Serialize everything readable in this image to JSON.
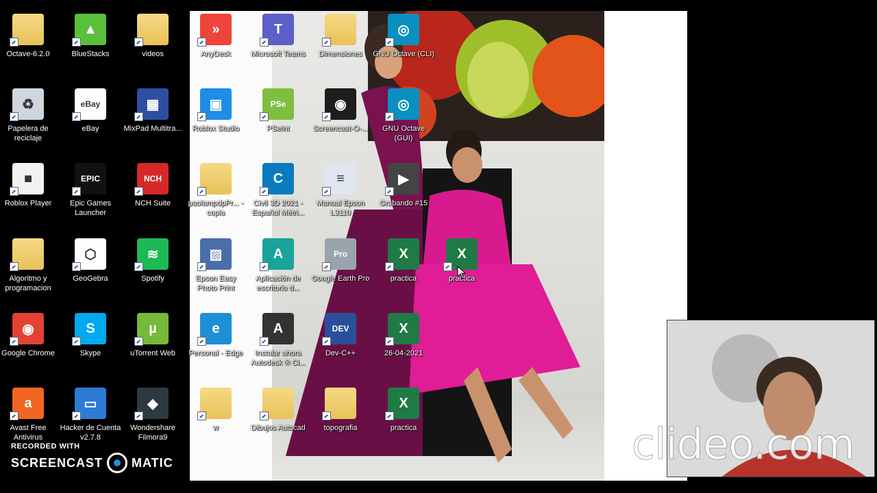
{
  "desktop": {
    "icons": [
      {
        "label": "Octave-6.2.0",
        "icon": "folder-icon",
        "color": "#f3d07a"
      },
      {
        "label": "BlueStacks",
        "icon": "bluestacks-icon",
        "color": "#5ac03a"
      },
      {
        "label": "videos",
        "icon": "folder-icon",
        "color": "#f3d07a"
      },
      {
        "label": "AnyDesk",
        "icon": "anydesk-icon",
        "color": "#ef443b"
      },
      {
        "label": "Microsoft Teams",
        "icon": "teams-icon",
        "color": "#5b5fc7"
      },
      {
        "label": "Dimensiones",
        "icon": "folder-icon",
        "color": "#f3d07a"
      },
      {
        "label": "GNU Octave (CLI)",
        "icon": "octave-icon",
        "color": "#0790c0"
      },
      {
        "label": "Papelera de reciclaje",
        "icon": "recycle-bin-icon",
        "color": "#cfd6dd"
      },
      {
        "label": "eBay",
        "icon": "ebay-icon",
        "color": "#ffffff"
      },
      {
        "label": "MixPad Multitra...",
        "icon": "mixpad-icon",
        "color": "#2d4fa3"
      },
      {
        "label": "Roblox Studio",
        "icon": "roblox-studio-icon",
        "color": "#1e8ce8"
      },
      {
        "label": "PSeInt",
        "icon": "pseint-icon",
        "color": "#7fbf3f"
      },
      {
        "label": "Screencast-O-...",
        "icon": "screencast-icon",
        "color": "#1d1d1d"
      },
      {
        "label": "GNU Octave (GUI)",
        "icon": "octave-icon",
        "color": "#0790c0"
      },
      {
        "label": "Roblox Player",
        "icon": "roblox-icon",
        "color": "#f2f2f2"
      },
      {
        "label": "Epic Games Launcher",
        "icon": "epic-games-icon",
        "color": "#111111"
      },
      {
        "label": "NCH Suite",
        "icon": "nch-icon",
        "color": "#d62828"
      },
      {
        "label": "paolampdpPr... - copia",
        "icon": "folder-icon",
        "color": "#f3d07a"
      },
      {
        "label": "Civil 3D 2021 - Español Métri...",
        "icon": "civil3d-icon",
        "color": "#0b7bbf"
      },
      {
        "label": "Manual Epson L3110",
        "icon": "document-icon",
        "color": "#dfe6ef"
      },
      {
        "label": "Grabando #15",
        "icon": "video-file-icon",
        "color": "#444444"
      },
      {
        "label": "Algoritmo y programacion",
        "icon": "folder-icon",
        "color": "#f3d07a"
      },
      {
        "label": "GeoGebra",
        "icon": "geogebra-icon",
        "color": "#ffffff"
      },
      {
        "label": "Spotify",
        "icon": "spotify-icon",
        "color": "#1db954"
      },
      {
        "label": "Epson Easy Photo Print",
        "icon": "epson-photo-icon",
        "color": "#4a6ea8"
      },
      {
        "label": "Aplicación de escritorio d...",
        "icon": "autodesk-app-icon",
        "color": "#1aa39a"
      },
      {
        "label": "Google Earth Pro",
        "icon": "google-earth-icon",
        "color": "#9aa4ad"
      },
      {
        "label": "practica",
        "icon": "excel-file-icon",
        "color": "#1f7a45"
      },
      {
        "label": "practica",
        "icon": "excel-file-icon",
        "color": "#1f7a45"
      },
      {
        "label": "Google Chrome",
        "icon": "chrome-icon",
        "color": "#e34133"
      },
      {
        "label": "Skype",
        "icon": "skype-icon",
        "color": "#00a9f0"
      },
      {
        "label": "uTorrent Web",
        "icon": "utorrent-icon",
        "color": "#78b83a"
      },
      {
        "label": "Personal - Edge",
        "icon": "edge-icon",
        "color": "#1d8fd6"
      },
      {
        "label": "Instalar ahora Autodesk ® Ci...",
        "icon": "autodesk-install-icon",
        "color": "#333333"
      },
      {
        "label": "Dev-C++",
        "icon": "devcpp-icon",
        "color": "#2a4f9a"
      },
      {
        "label": "26-04-2021",
        "icon": "excel-file-icon",
        "color": "#1f7a45"
      },
      {
        "label": "Avast Free Antivirus",
        "icon": "avast-icon",
        "color": "#f26522"
      },
      {
        "label": "Hacker de Cuenta v2.7.8",
        "icon": "app-window-icon",
        "color": "#2e7bd6"
      },
      {
        "label": "Wondershare Filmora9",
        "icon": "filmora-icon",
        "color": "#2b3a3f"
      },
      {
        "label": "w",
        "icon": "folder-icon",
        "color": "#f3d07a"
      },
      {
        "label": "Dibujos Autocad",
        "icon": "folder-icon",
        "color": "#f3d07a"
      },
      {
        "label": "topografia",
        "icon": "folder-icon",
        "color": "#f3d07a"
      },
      {
        "label": "practica",
        "icon": "excel-file-icon",
        "color": "#1f7a45"
      }
    ]
  },
  "overlay": {
    "recorded_with": "RECORDED WITH",
    "screencast_left": "SCREENCAST",
    "screencast_right": "MATIC",
    "watermark": "clideo.com"
  }
}
